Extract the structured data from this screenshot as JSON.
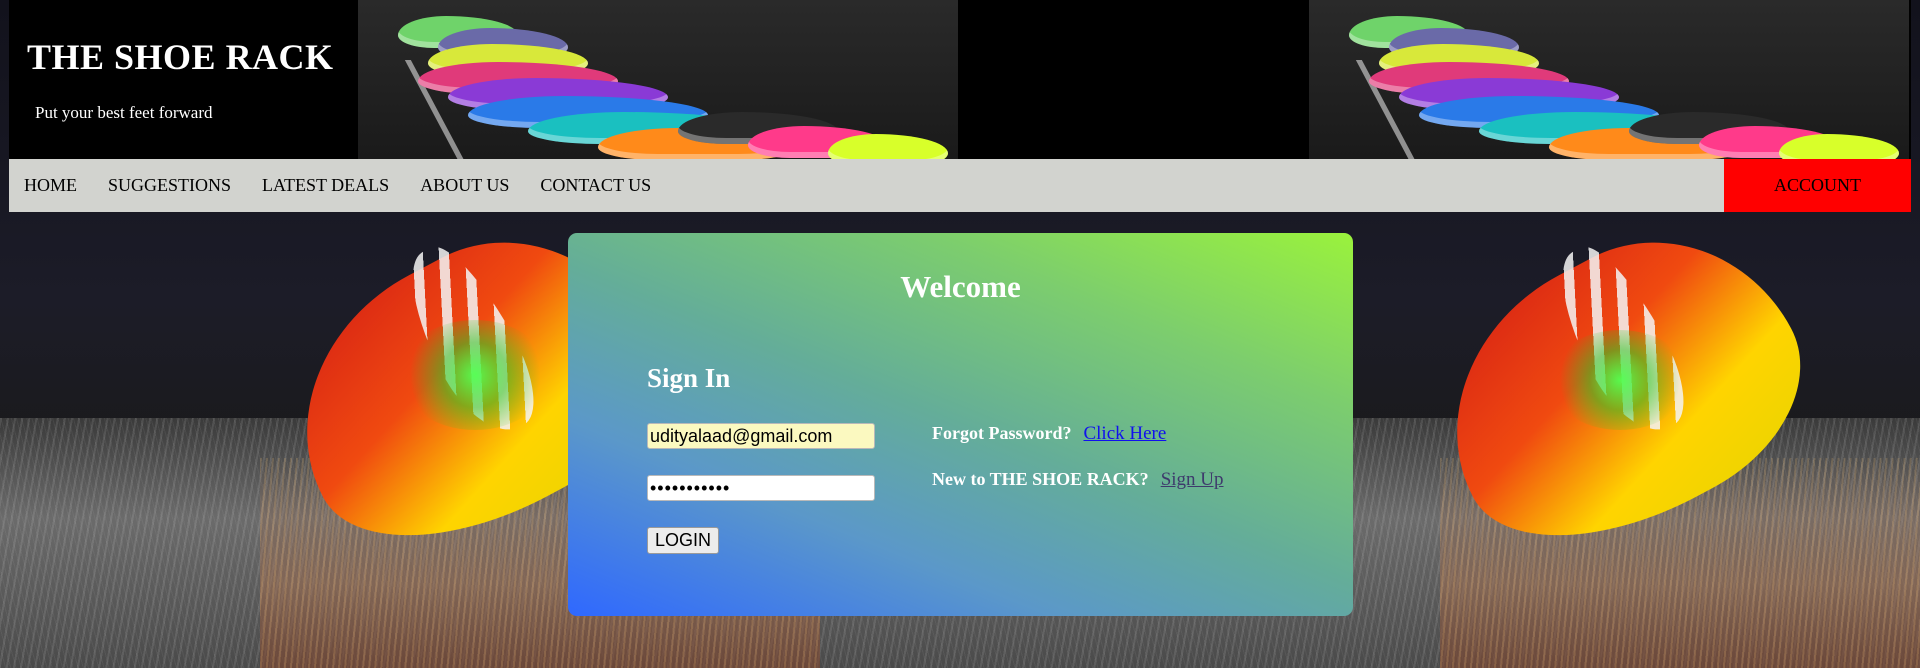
{
  "header": {
    "title": "THE SHOE RACK",
    "tagline": "Put your best feet forward"
  },
  "nav": {
    "items": [
      "HOME",
      "SUGGESTIONS",
      "LATEST DEALS",
      "ABOUT US",
      "CONTACT US"
    ],
    "account_label": "ACCOUNT"
  },
  "login": {
    "heading": "Welcome",
    "subheading": "Sign In",
    "email_value": "udityalaad@gmail.com",
    "password_value": "•••••••••••",
    "login_button": "LOGIN",
    "forgot_text": "Forgot Password?",
    "forgot_link": "Click Here",
    "new_text": "New to THE SHOE RACK?",
    "signup_link": "Sign Up"
  },
  "colors": {
    "nav_bg": "#d2d3cf",
    "account_bg": "#ff0000",
    "header_bg": "#000000",
    "card_gradient_start": "#2f68ff",
    "card_gradient_end": "#9af23c"
  }
}
